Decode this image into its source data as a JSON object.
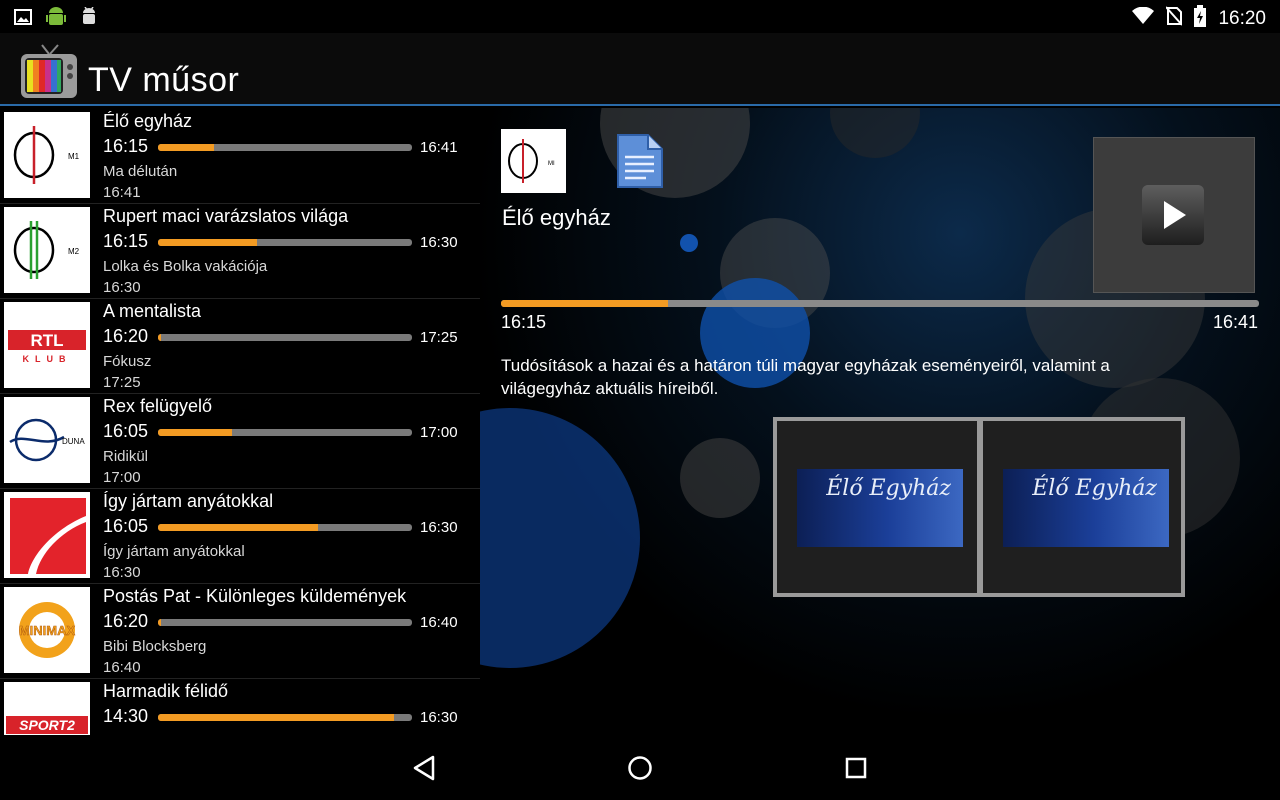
{
  "status_bar": {
    "time": "16:20",
    "left_icons": [
      "image-icon",
      "android-icon",
      "android-debug-icon"
    ],
    "right_icons": [
      "wifi-icon",
      "no-sim-icon",
      "battery-charging-icon"
    ]
  },
  "app": {
    "title": "TV műsor",
    "icon": "tv-app-icon"
  },
  "colors": {
    "progress": "#f39b23",
    "track": "#7a7a7a",
    "accent_rule": "#2a6aa8"
  },
  "channels": [
    {
      "logo": "M1",
      "title": "Élő egyház",
      "start": "16:15",
      "end": "16:41",
      "progress": 0.22,
      "next_title": "Ma délután",
      "next_time": "16:41"
    },
    {
      "logo": "M2",
      "title": "Rupert maci varázslatos világa",
      "start": "16:15",
      "end": "16:30",
      "progress": 0.39,
      "next_title": "Lolka és Bolka vakációja",
      "next_time": "16:30"
    },
    {
      "logo": "RTL KLUB",
      "title": "A mentalista",
      "start": "16:20",
      "end": "17:25",
      "progress": 0.01,
      "next_title": "Fókusz",
      "next_time": "17:25"
    },
    {
      "logo": "DUNA",
      "title": "Rex felügyelő",
      "start": "16:05",
      "end": "17:00",
      "progress": 0.29,
      "next_title": "Ridikül",
      "next_time": "17:00"
    },
    {
      "logo": "PRO7",
      "title": "Így jártam anyátokkal",
      "start": "16:05",
      "end": "16:30",
      "progress": 0.63,
      "next_title": "Így jártam anyátokkal",
      "next_time": "16:30"
    },
    {
      "logo": "MINIMAX",
      "title": "Postás Pat - Különleges küldemények",
      "start": "16:20",
      "end": "16:40",
      "progress": 0.01,
      "next_title": "Bibi Blocksberg",
      "next_time": "16:40"
    },
    {
      "logo": "SPORT2",
      "title": "Harmadik félidő",
      "start": "14:30",
      "end": "16:30",
      "progress": 0.93,
      "next_title": "",
      "next_time": ""
    }
  ],
  "detail": {
    "logo": "M1",
    "title": "Élő egyház",
    "start": "16:15",
    "end": "16:41",
    "progress": 0.22,
    "description": "Tudósítások a hazai és a határon túli magyar egyházak eseményeiről, valamint a világegyház aktuális híreiből.",
    "thumbnail_text": "Élő Egyház",
    "icons": [
      "document-icon",
      "play-icon"
    ]
  },
  "nav": {
    "icons": [
      "back-icon",
      "home-icon",
      "recents-icon"
    ]
  }
}
